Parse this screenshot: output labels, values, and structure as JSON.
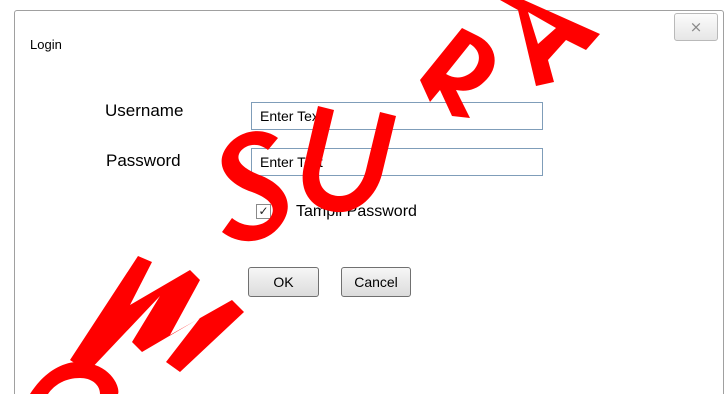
{
  "window": {
    "title": "Login",
    "close_glyph": "×"
  },
  "form": {
    "username_label": "Username",
    "username_value": "Enter Text",
    "password_label": "Password",
    "password_value": "Enter Text",
    "show_password_label": "Tampil Password",
    "show_password_checked": true,
    "checkbox_glyph": "✓",
    "ok_label": "OK",
    "cancel_label": "Cancel"
  },
  "watermark": {
    "text": "STIMIK SURABAYA",
    "color": "#ff0000"
  }
}
